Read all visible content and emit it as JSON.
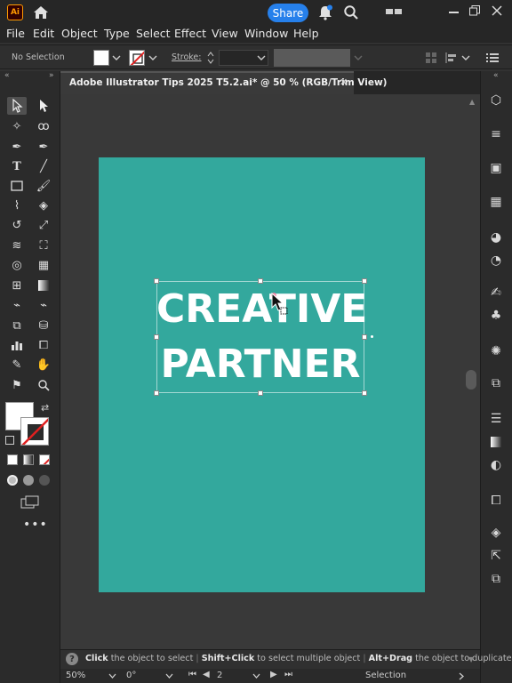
{
  "app": {
    "logo_text": "Ai",
    "share_label": "Share",
    "colors": {
      "accent": "#2680eb",
      "artboard": "#33a89d",
      "logo_bg": "#330000",
      "logo_fg": "#ff9a00"
    }
  },
  "menu": {
    "items": [
      "File",
      "Edit",
      "Object",
      "Type",
      "Select",
      "Effect",
      "View",
      "Window",
      "Help"
    ]
  },
  "control_bar": {
    "selection_label": "No Selection",
    "stroke_label": "Stroke:"
  },
  "document": {
    "tab_title": "Adobe Illustrator Tips 2025 T5.2.ai* @ 50 % (RGB/Trim View)",
    "close_glyph": "✕",
    "artwork_line1": "CREATIVE",
    "artwork_line2": "PARTNER"
  },
  "status": {
    "hint_part1_bold": "Click",
    "hint_part1": " the object to select",
    "hint_part2_bold": "Shift+Click",
    "hint_part2": " to select multiple object",
    "hint_part3_bold": "Alt+Drag",
    "hint_part3": " the object to duplicate"
  },
  "bottom": {
    "zoom": "50%",
    "rotation": "0°",
    "artboard_number": "2",
    "tool_name": "Selection"
  },
  "icons": {
    "home": "home-icon",
    "bell": "bell-icon",
    "search": "search-icon",
    "more": "more-icon"
  }
}
